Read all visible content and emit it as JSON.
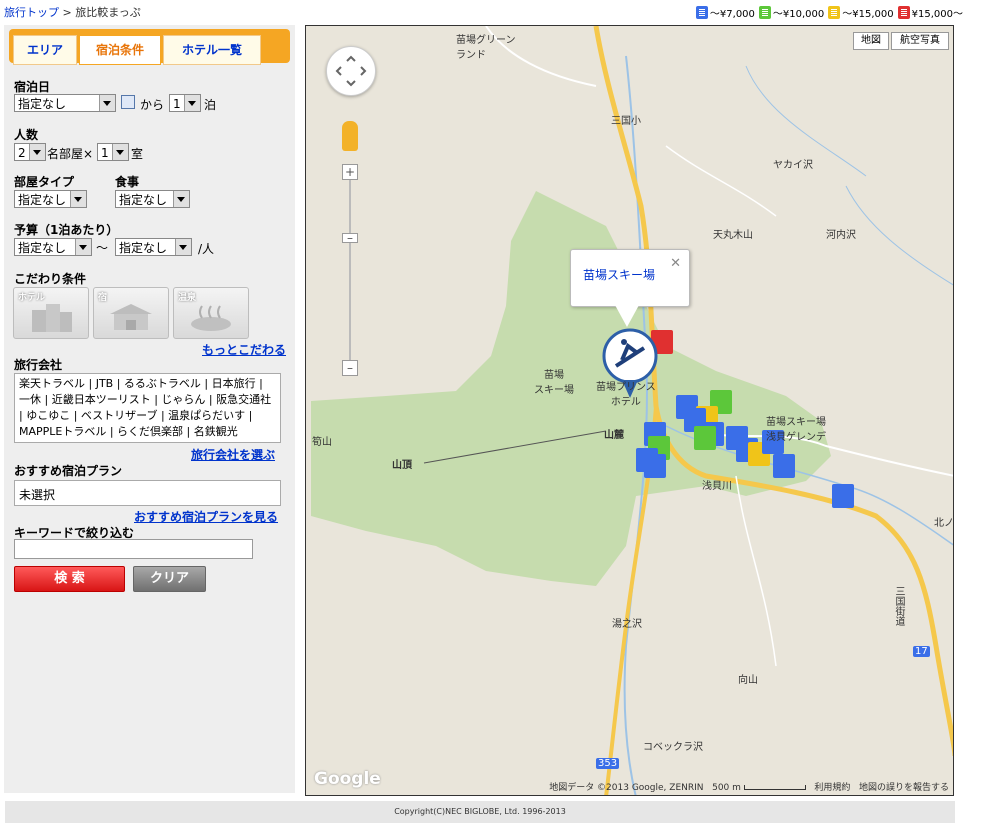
{
  "breadcrumb": {
    "home": "旅行トップ",
    "sep": " > ",
    "current": "旅比較まっぷ"
  },
  "legend": [
    {
      "label": "～¥7,000",
      "color": "#3a6ee8"
    },
    {
      "label": "～¥10,000",
      "color": "#5cc73a"
    },
    {
      "label": "～¥15,000",
      "color": "#f0c419"
    },
    {
      "label": "¥15,000～",
      "color": "#e03030"
    }
  ],
  "tabs": {
    "area": "エリア",
    "conditions": "宿泊条件",
    "hotel_list": "ホテル一覧"
  },
  "search": {
    "date_label": "宿泊日",
    "date_value": "指定なし",
    "from": "から",
    "nights_value": "1",
    "nights_unit": "泊",
    "people_label": "人数",
    "people_value": "2",
    "per_room": "名部屋×",
    "rooms_value": "1",
    "rooms_unit": "室",
    "roomtype_label": "部屋タイプ",
    "roomtype_value": "指定なし",
    "meal_label": "食事",
    "meal_value": "指定なし",
    "budget_label": "予算（1泊あたり）",
    "budget_min": "指定なし",
    "budget_sep": "～",
    "budget_max": "指定なし",
    "budget_unit": "/人",
    "kodawari_label": "こだわり条件",
    "kodawari": {
      "hotel": "ホテル",
      "yado": "宿",
      "onsen": "温泉"
    },
    "more_kodawari": "もっとこだわる",
    "agency_label": "旅行会社",
    "agencies": "楽天トラベル | JTB | るるぶトラベル | 日本旅行 | 一休 | 近畿日本ツーリスト | じゃらん | 阪急交通社 | ゆこゆこ | ベストリザーブ | 温泉ぱらだいす | MAPPLEトラベル | らくだ倶楽部 | 名鉄観光",
    "choose_agency": "旅行会社を選ぶ",
    "plan_label": "おすすめ宿泊プラン",
    "plan_value": "未選択",
    "see_plan": "おすすめ宿泊プランを見る",
    "keyword_label": "キーワードで絞り込む",
    "keyword_value": "",
    "search_button": "検 索",
    "clear_button": "クリア"
  },
  "map": {
    "type_map": "地図",
    "type_aerial": "航空写真",
    "popup_title": "苗場スキー場",
    "labels": {
      "green_land": "苗場グリーン\nランド",
      "mikuni": "三国小",
      "yakai": "ヤカイ沢",
      "tenmaru": "天丸木山",
      "kawauchi": "河内沢",
      "naeba_ski_left": "苗場\nスキー場",
      "prince": "苗場プリンス\nホテル",
      "sanroku": "山麓",
      "sancho": "山頂",
      "tsuboyama": "筍山",
      "asakai": "浅貝川",
      "naeba_gelande": "苗場スキー場\n浅貝ゲレンデ",
      "yunosawa": "湯之沢",
      "mukaiyama": "向山",
      "kobekkura": "コベックラ沢",
      "kitano": "北ノ",
      "mikuni_kaido": "三国街道",
      "r17": "17",
      "r353": "353"
    },
    "google": "Google",
    "attribution": "地図データ ©2013 Google, ZENRIN",
    "scale": "500 m",
    "terms": "利用規約",
    "report": "地図の誤りを報告する"
  },
  "footer": "Copyright(C)NEC BIGLOBE, Ltd. 1996-2013"
}
